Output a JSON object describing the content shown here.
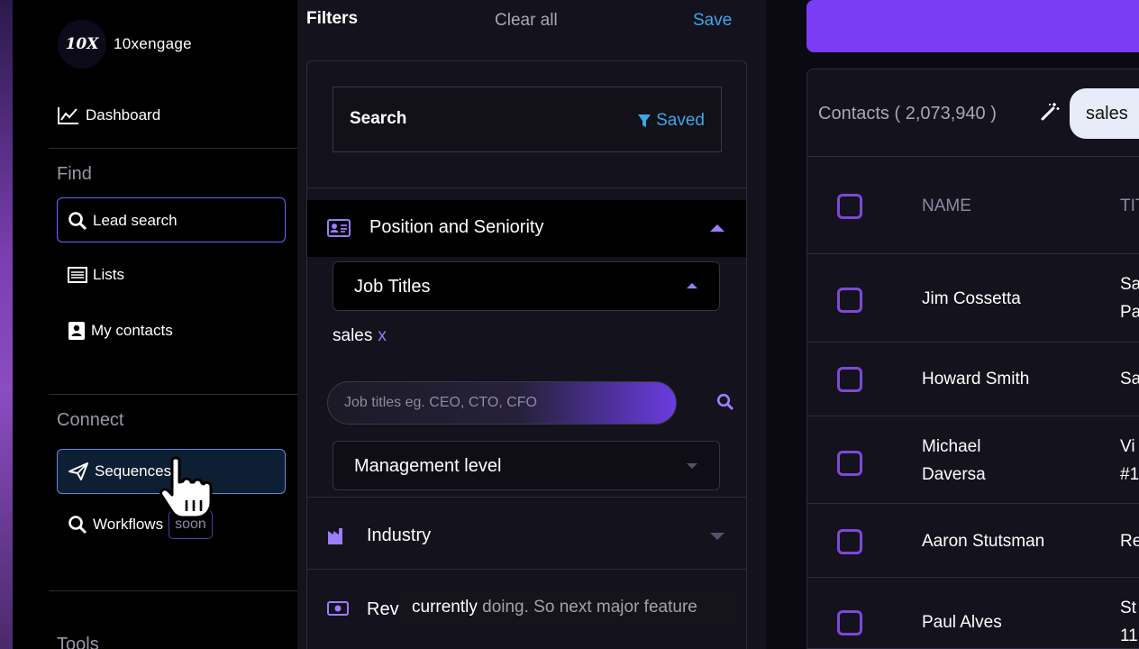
{
  "app": {
    "logo_mark": "10X",
    "name": "10xengage"
  },
  "sidebar": {
    "dashboard": "Dashboard",
    "find_label": "Find",
    "lead_search": "Lead search",
    "lists": "Lists",
    "my_contacts": "My contacts",
    "connect_label": "Connect",
    "sequences": "Sequences",
    "workflows": "Workflows",
    "soon_badge": "soon",
    "tools_label": "Tools"
  },
  "filters": {
    "title": "Filters",
    "clear_all": "Clear all",
    "save": "Save",
    "search_label": "Search",
    "saved_label": "Saved",
    "position_section": "Position and Seniority",
    "job_titles": "Job Titles",
    "selected_tag": "sales",
    "tag_remove": "x",
    "job_placeholder": "Job titles eg. CEO, CTO, CFO",
    "management_level": "Management level",
    "industry": "Industry",
    "revenue_partial": "Reve"
  },
  "table": {
    "contacts_label": "Contacts ( 2,073,940 )",
    "query_chip": "sales",
    "header_name": "NAME",
    "header_title_partial": "TIT",
    "rows": [
      {
        "name_line1": "Jim Cossetta",
        "name_line2": "",
        "title_line1": "Sa",
        "title_line2": "Pa"
      },
      {
        "name_line1": "Howard Smith",
        "name_line2": "",
        "title_line1": "Sa",
        "title_line2": ""
      },
      {
        "name_line1": "Michael",
        "name_line2": "Daversa",
        "title_line1": "Vi",
        "title_line2": "#1"
      },
      {
        "name_line1": "Aaron Stutsman",
        "name_line2": "",
        "title_line1": "Re",
        "title_line2": ""
      },
      {
        "name_line1": "Paul Alves",
        "name_line2": "",
        "title_line1": "St",
        "title_line2": "11"
      }
    ]
  },
  "caption": {
    "highlight": "currently",
    "rest": " doing. So next major feature"
  },
  "colors": {
    "accent": "#7b3cf5",
    "link": "#3aa8e8",
    "checkbox": "#7d49d6"
  }
}
